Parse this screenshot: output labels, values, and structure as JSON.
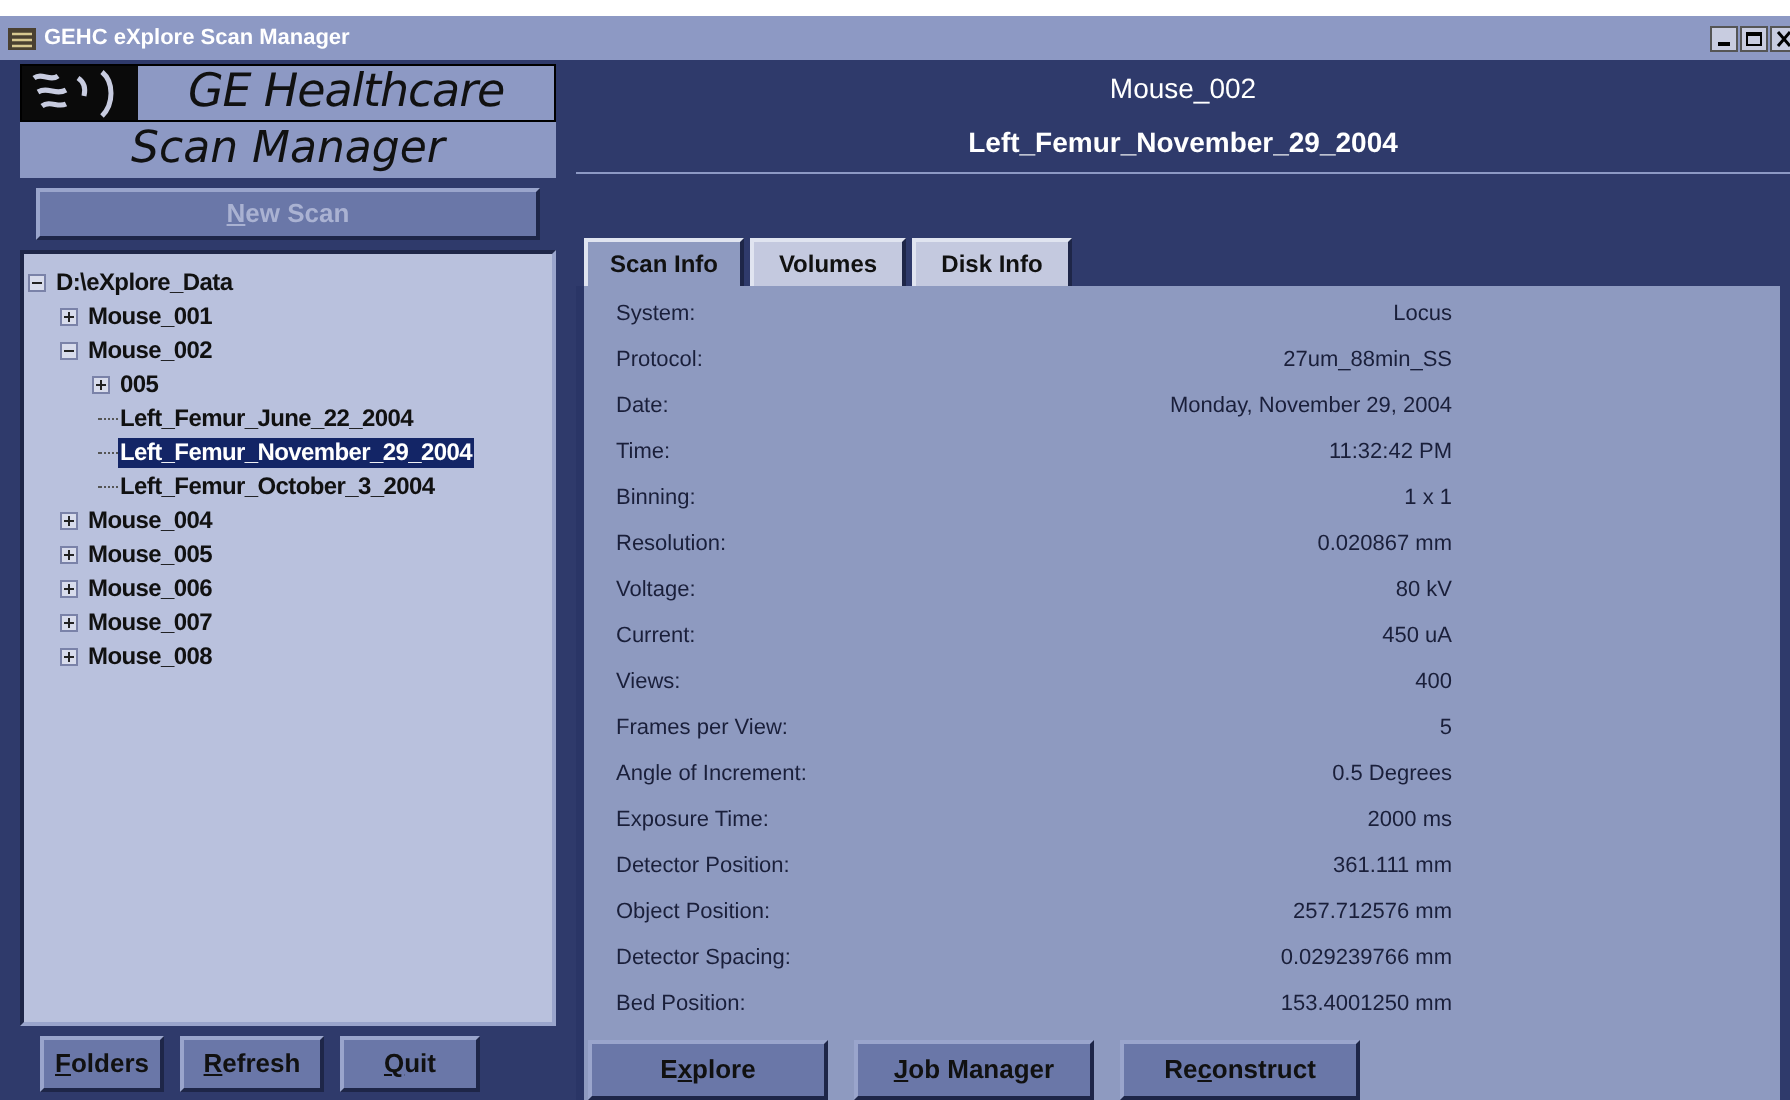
{
  "window": {
    "title": "GEHC eXplore Scan Manager"
  },
  "logo": {
    "brand": "GE Healthcare",
    "product": "Scan Manager"
  },
  "new_scan_button": {
    "mnemonic": "N",
    "after": "ew Scan"
  },
  "header": {
    "subject": "Mouse_002",
    "scan": "Left_Femur_November_29_2004"
  },
  "tree": [
    {
      "label": "D:\\eXplore_Data",
      "expanded": true,
      "selected": false,
      "children": [
        {
          "label": "Mouse_001",
          "expanded": false,
          "selected": false
        },
        {
          "label": "Mouse_002",
          "expanded": true,
          "selected": false,
          "children": [
            {
              "label": "005",
              "expanded": false,
              "selected": false
            },
            {
              "label": "Left_Femur_June_22_2004",
              "selected": false
            },
            {
              "label": "Left_Femur_November_29_2004",
              "selected": true
            },
            {
              "label": "Left_Femur_October_3_2004",
              "selected": false
            }
          ]
        },
        {
          "label": "Mouse_004",
          "expanded": false,
          "selected": false
        },
        {
          "label": "Mouse_005",
          "expanded": false,
          "selected": false
        },
        {
          "label": "Mouse_006",
          "expanded": false,
          "selected": false
        },
        {
          "label": "Mouse_007",
          "expanded": false,
          "selected": false
        },
        {
          "label": "Mouse_008",
          "expanded": false,
          "selected": false
        }
      ]
    }
  ],
  "left_buttons": [
    {
      "mnemonic": "F",
      "after": "olders"
    },
    {
      "mnemonic": "R",
      "after": "efresh"
    },
    {
      "mnemonic": "Q",
      "after": "uit"
    }
  ],
  "tabs": [
    {
      "label": "Scan Info",
      "selected": true
    },
    {
      "label": "Volumes",
      "selected": false
    },
    {
      "label": "Disk Info",
      "selected": false
    }
  ],
  "scan_info": [
    {
      "label": "System:",
      "value": "Locus"
    },
    {
      "label": "Protocol:",
      "value": "27um_88min_SS"
    },
    {
      "label": "Date:",
      "value": "Monday, November 29, 2004"
    },
    {
      "label": "Time:",
      "value": "11:32:42 PM"
    },
    {
      "label": "Binning:",
      "value": "1 x 1"
    },
    {
      "label": "Resolution:",
      "value": "0.020867 mm"
    },
    {
      "label": "Voltage:",
      "value": "80 kV"
    },
    {
      "label": "Current:",
      "value": "450 uA"
    },
    {
      "label": "Views:",
      "value": "400"
    },
    {
      "label": "Frames per View:",
      "value": "5"
    },
    {
      "label": "Angle of Increment:",
      "value": "0.5 Degrees"
    },
    {
      "label": "Exposure Time:",
      "value": "2000 ms"
    },
    {
      "label": "Detector Position:",
      "value": "361.111 mm"
    },
    {
      "label": "Object Position:",
      "value": "257.712576 mm"
    },
    {
      "label": "Detector Spacing:",
      "value": "0.029239766 mm"
    },
    {
      "label": "Bed Position:",
      "value": "153.4001250 mm"
    }
  ],
  "action_buttons": [
    {
      "before": "E",
      "mnemonic": "x",
      "after": "plore"
    },
    {
      "mnemonic": "J",
      "after": "ob Manager"
    },
    {
      "before": "Re",
      "mnemonic": "c",
      "after": "onstruct"
    }
  ]
}
